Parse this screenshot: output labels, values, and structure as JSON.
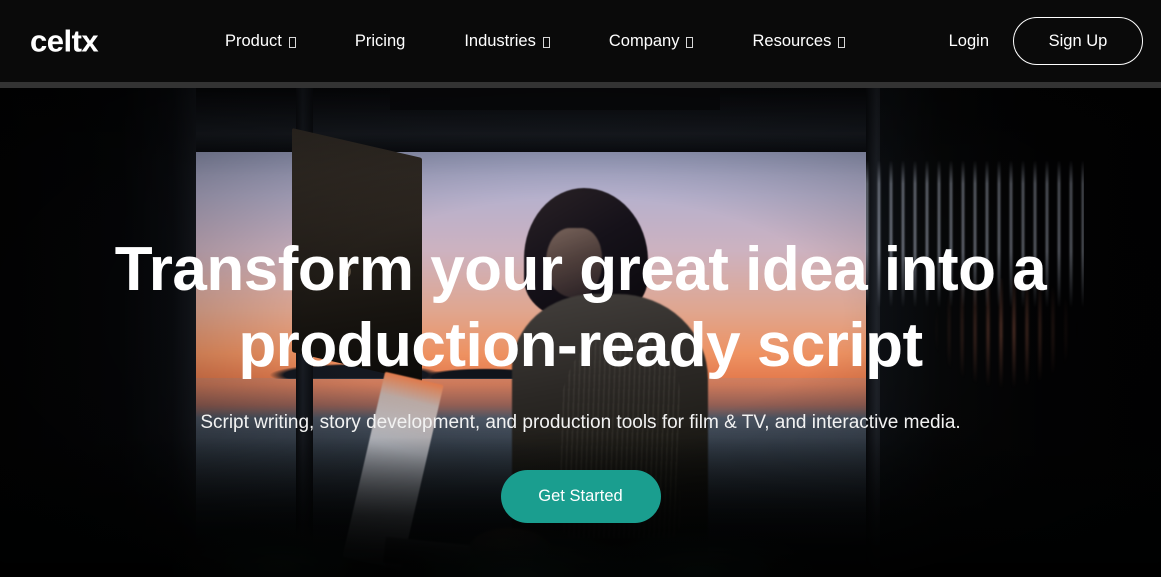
{
  "brand": {
    "logo_text": "celtx",
    "accent_color": "#1a9e8f",
    "header_bg": "#0a0a0a",
    "divider_color": "#333333"
  },
  "header": {
    "nav_items": [
      {
        "label": "Product",
        "has_dropdown": true,
        "icon": "chevron-down-icon"
      },
      {
        "label": "Pricing",
        "has_dropdown": false,
        "icon": ""
      },
      {
        "label": "Industries",
        "has_dropdown": true,
        "icon": "chevron-down-icon"
      },
      {
        "label": "Company",
        "has_dropdown": true,
        "icon": "chevron-down-icon"
      },
      {
        "label": "Resources",
        "has_dropdown": true,
        "icon": "chevron-down-icon"
      }
    ],
    "login_label": "Login",
    "signup_label": "Sign Up"
  },
  "hero": {
    "title_line1": "Transform your great idea into a",
    "title_line2": "production-ready script",
    "subtitle": "Script writing, story development, and production tools for film & TV, and interactive media.",
    "cta_label": "Get Started",
    "background_description": "person-with-laptop-at-sunset-window"
  }
}
